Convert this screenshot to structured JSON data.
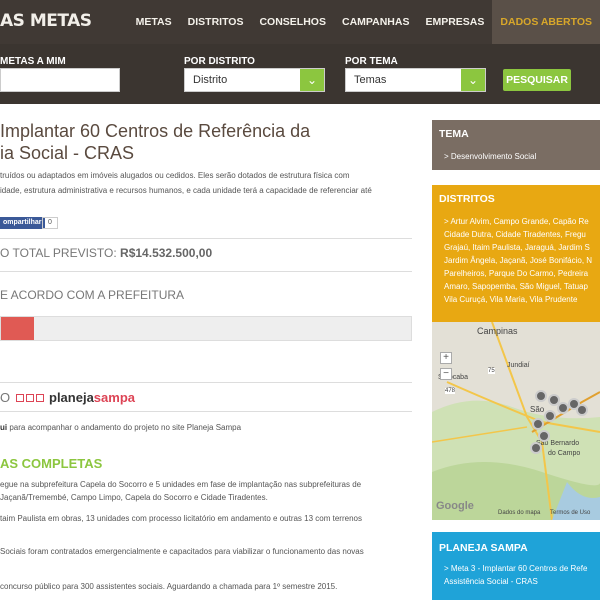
{
  "header": {
    "logo": "AS METAS",
    "nav": [
      "METAS",
      "DISTRITOS",
      "CONSELHOS",
      "CAMPANHAS",
      "EMPRESAS",
      "DADOS ABERTOS"
    ]
  },
  "filters": {
    "metas_label": "METAS A MIM",
    "metas_value": "",
    "distrito_label": "POR DISTRITO",
    "distrito_value": "Distrito",
    "tema_label": "POR TEMA",
    "tema_value": "Temas",
    "search_label": "PESQUISAR"
  },
  "main": {
    "title": "Implantar 60 Centros de Referência da Assistência Social - CRAS",
    "title_line1": "Implantar 60 Centros de Referência da",
    "title_line2": "ia Social - CRAS",
    "desc_line1": "truídos ou adaptados em imóveis alugados ou cedidos. Eles serão dotados de estrutura física com",
    "desc_line2": "idade, estrutura administrativa e recursos humanos, e cada unidade terá a capacidade de referenciar até",
    "share_label": "ompartilhar",
    "share_count": "0",
    "cost_prefix": "O TOTAL PREVISTO:",
    "cost_value": "R$14.532.500,00",
    "status": "E ACORDO COM A PREFEITURA",
    "progress": 0.08,
    "planeja_prefix": "O",
    "planeja_logo_part1": "planeja",
    "planeja_logo_part2": "sampa",
    "follow_bold": "ui",
    "follow_text": " para acompanhar o andamento do projeto no site Planeja Sampa",
    "section_title": "AS COMPLETAS",
    "bullets": [
      "egue na subprefeitura Capela do Socorro e 5 unidades em fase de implantação nas subprefeituras de",
      "Jaçanã/Tremembé, Campo Limpo, Capela do Socorro e Cidade Tiradentes.",
      "taim Paulista em obras, 13 unidades com processo licitatório em andamento e outras 13 com terrenos",
      "Sociais foram contratados emergencialmente e capacitados para viabilizar o funcionamento das novas",
      "concurso público para 300 assistentes sociais. Aguardando a chamada para 1º semestre 2015."
    ]
  },
  "sidebar": {
    "tema_title": "TEMA",
    "tema_item": "> Desenvolvimento Social",
    "distritos_title": "DISTRITOS",
    "distritos_lines": [
      "> Artur Alvim, Campo Grande, Capão Re",
      "Cidade Dutra, Cidade Tiradentes, Fregu",
      "Grajaú, Itaim Paulista, Jaraguá, Jardim S",
      "Jardim Ângela, Jaçanã, José Bonifácio, N",
      "Parelheiros, Parque Do Carmo, Pedreira",
      "Amaro, Sapopemba, São Miguel, Tatuap",
      "Vila Curuçá, Vila Maria, Vila Prudente"
    ],
    "planeja_title": "PLANEJA SAMPA",
    "planeja_lines": [
      "> Meta 3 - Implantar 60 Centros de Refe",
      "Assistência Social - CRAS"
    ],
    "map": {
      "campinas": "Campinas",
      "jundiai": "Jundiaí",
      "sorocaba": "Sorocaba",
      "sao_paulo": "São",
      "sao_bernardo": "São Bernardo",
      "do_campo": "do Campo",
      "google": "Google",
      "dados": "Dados do mapa",
      "termos": "Termos de Uso",
      "road_478": "478",
      "road_75": "75"
    }
  },
  "colors": {
    "topbar": "#403934",
    "accent_green": "#8cc63f",
    "tema_bg": "#7a6d63",
    "distritos_bg": "#e8a812",
    "planeja_bg": "#1fa3d8",
    "progress_red": "#e05a54"
  }
}
